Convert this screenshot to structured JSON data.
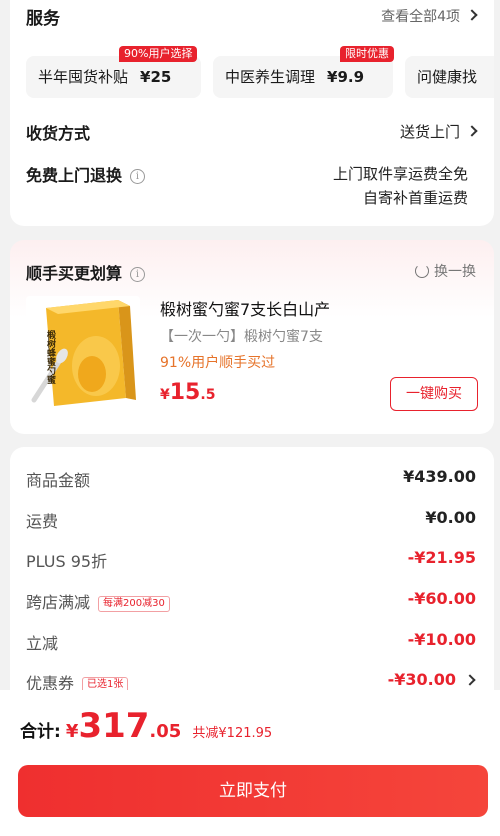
{
  "services": {
    "title": "服务",
    "view_all": "查看全部4项",
    "chips": [
      {
        "label": "半年囤货补贴",
        "price": "¥25",
        "badge": "90%用户选择"
      },
      {
        "label": "中医养生调理",
        "price": "¥9.9",
        "badge": "限时优惠"
      },
      {
        "label": "问健康找",
        "price": "",
        "badge": ""
      }
    ]
  },
  "delivery": {
    "label": "收货方式",
    "value": "送货上门"
  },
  "returns": {
    "label": "免费上门退换",
    "line1": "上门取件享运费全免",
    "line2": "自寄补首重运费"
  },
  "addon": {
    "title": "顺手买更划算",
    "swap": "换一换",
    "product_name": "椴树蜜勺蜜7支长白山产",
    "product_sub": "【一次一勺】椴树勺蜜7支",
    "product_stat": "91%用户顺手买过",
    "price_symbol": "¥",
    "price_int": "15",
    "price_dec": ".5",
    "buy_label": "一键购买",
    "image_text": "椴树蜂蜜勺蜜"
  },
  "amounts": [
    {
      "label": "商品金额",
      "value": "¥439.00",
      "tag": ""
    },
    {
      "label": "运费",
      "value": "¥0.00",
      "tag": ""
    },
    {
      "label": "PLUS 95折",
      "value": "-¥21.95",
      "tag": ""
    },
    {
      "label": "跨店满减",
      "value": "-¥60.00",
      "tag": "每满200减30"
    },
    {
      "label": "立减",
      "value": "-¥10.00",
      "tag": ""
    },
    {
      "label": "优惠券",
      "value": "-¥30.00",
      "tag": "已选1张"
    }
  ],
  "footer": {
    "total_label": "合计:",
    "total_symbol": "¥",
    "total_int": "317",
    "total_dec": ".05",
    "saved": "共减¥121.95",
    "pay_label": "立即支付"
  },
  "colors": {
    "accent": "#e8222d",
    "orange": "#e6732a",
    "page_bg": "#f2f2f2"
  }
}
